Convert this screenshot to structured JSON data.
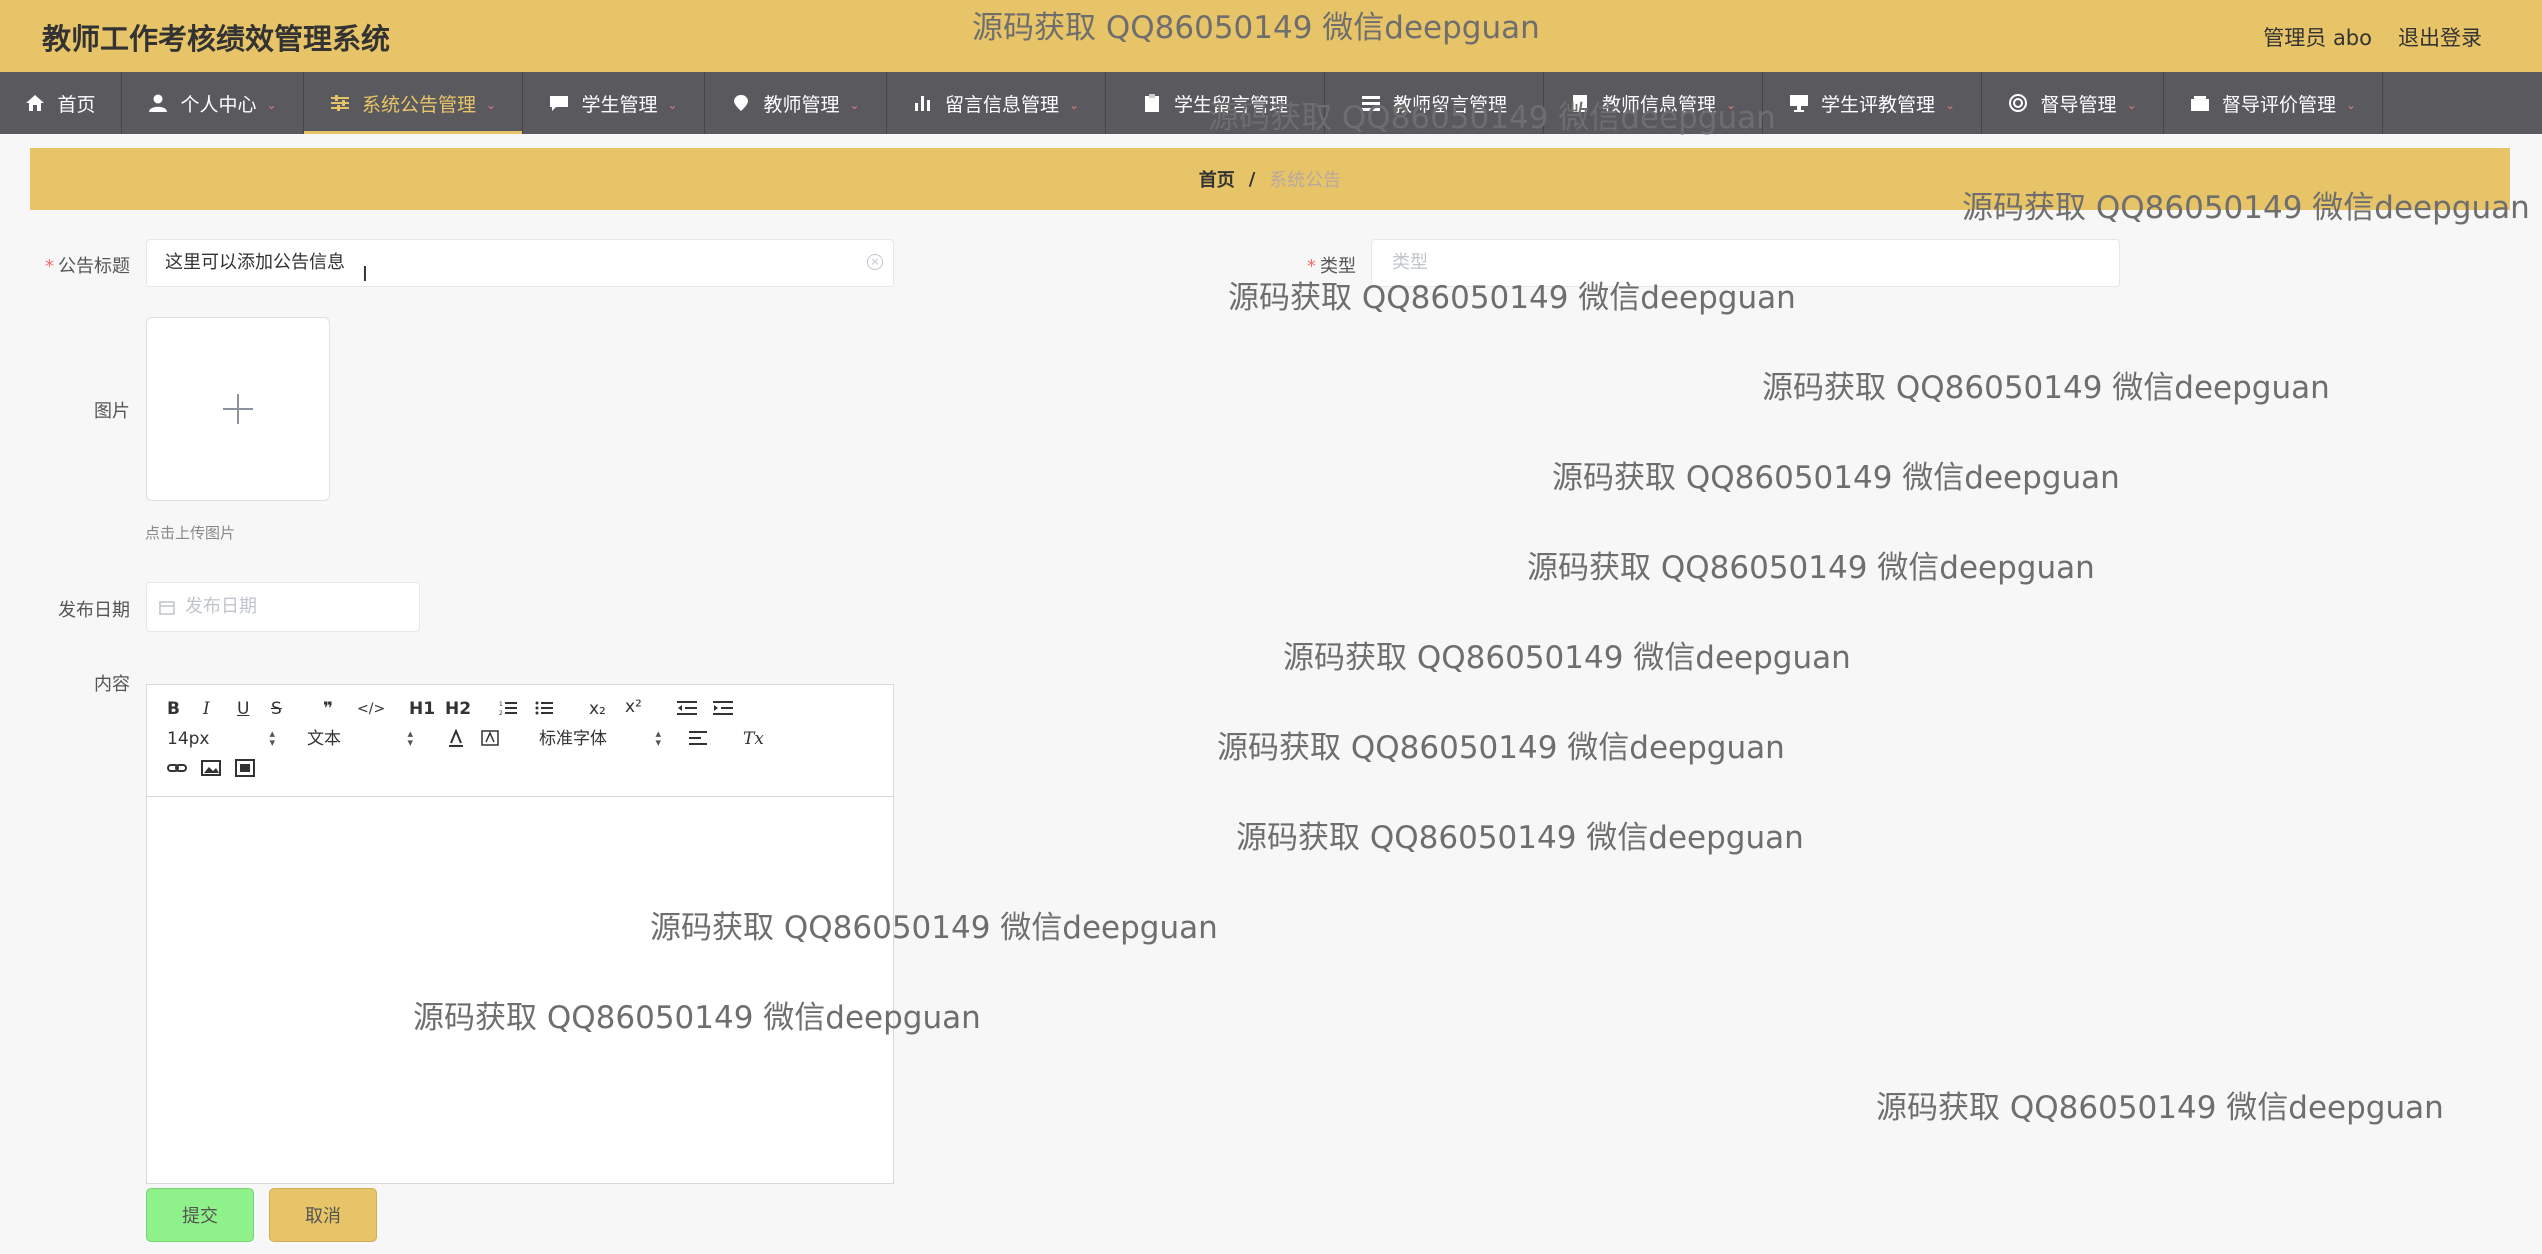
{
  "app": {
    "title": "教师工作考核绩效管理系统",
    "user": "管理员 abo",
    "logout": "退出登录"
  },
  "nav": [
    {
      "label": "首页",
      "icon": "home-icon",
      "dropdown": false
    },
    {
      "label": "个人中心",
      "icon": "user-icon",
      "dropdown": true
    },
    {
      "label": "系统公告管理",
      "icon": "sliders-icon",
      "dropdown": true,
      "active": true
    },
    {
      "label": "学生管理",
      "icon": "chat-icon",
      "dropdown": true
    },
    {
      "label": "教师管理",
      "icon": "location-icon",
      "dropdown": true
    },
    {
      "label": "留言信息管理",
      "icon": "bar-chart-icon",
      "dropdown": true
    },
    {
      "label": "学生留言管理",
      "icon": "clipboard-icon",
      "dropdown": true
    },
    {
      "label": "教师留言管理",
      "icon": "list-icon",
      "dropdown": true
    },
    {
      "label": "教师信息管理",
      "icon": "document-icon",
      "dropdown": true
    },
    {
      "label": "学生评教管理",
      "icon": "monitor-icon",
      "dropdown": true
    },
    {
      "label": "督导管理",
      "icon": "target-icon",
      "dropdown": true
    },
    {
      "label": "督导评价管理",
      "icon": "wallet-icon",
      "dropdown": true
    }
  ],
  "breadcrumb": {
    "home": "首页",
    "separator": "/",
    "current": "系统公告"
  },
  "form": {
    "title_label": "公告标题",
    "title_value": "这里可以添加公告信息",
    "type_label": "类型",
    "type_placeholder": "类型",
    "image_label": "图片",
    "upload_hint": "点击上传图片",
    "date_label": "发布日期",
    "date_placeholder": "发布日期",
    "content_label": "内容",
    "required_mark": "*"
  },
  "editor": {
    "font_size": "14px",
    "header": "文本",
    "font_family": "标准字体",
    "buttons": {
      "bold": "B",
      "italic": "I",
      "underline": "U",
      "strike": "S",
      "quote": "❞",
      "code": "</>",
      "h1": "H1",
      "h2": "H2",
      "sub": "x₂",
      "sup": "x²",
      "clean": "Tx"
    }
  },
  "buttons": {
    "submit": "提交",
    "cancel": "取消"
  },
  "watermark": "源码获取 QQ86050149 微信deepguan",
  "colors": {
    "topbar": "#e8c468",
    "nav": "#5a5a5e",
    "submit": "#8ef18a",
    "cancel": "#e8c468",
    "required": "#f56c6c"
  }
}
